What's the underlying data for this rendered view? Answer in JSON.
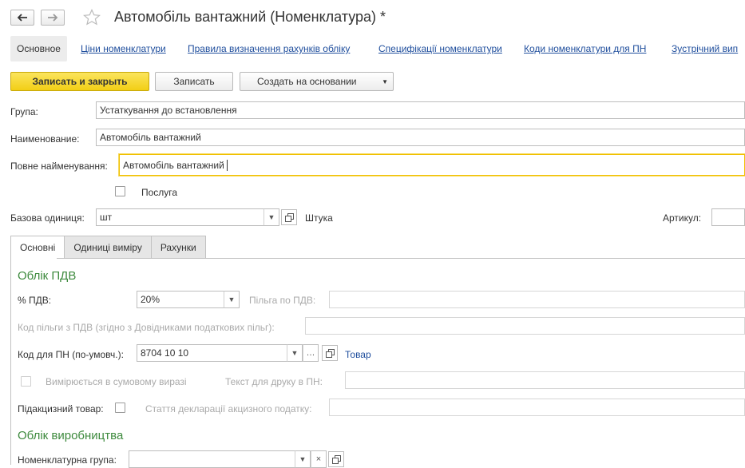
{
  "window": {
    "title": "Автомобіль вантажний (Номенклатура) *",
    "back_icon": "arrow-left-icon",
    "forward_icon": "arrow-right-icon",
    "favorite_icon": "star-icon"
  },
  "nav_tabs": {
    "main": "Основное",
    "links": [
      "Ціни номенклатури",
      "Правила визначення рахунків обліку",
      "Специфікації номенклатури",
      "Коди номенклатури для ПН",
      "Зустрічний вип"
    ]
  },
  "toolbar": {
    "save_close": "Записать и закрыть",
    "save": "Записать",
    "create_based": "Создать на основании"
  },
  "form": {
    "group_label": "Група:",
    "group_value": "Устаткування до встановлення",
    "name_label": "Наименование:",
    "name_value": "Автомобіль вантажний",
    "full_name_label": "Повне найменування:",
    "full_name_value": "Автомобіль вантажний",
    "service_label": "Послуга",
    "service_checked": false,
    "base_unit_label": "Базова одиниця:",
    "base_unit_value": "шт",
    "base_unit_full": "Штука",
    "article_label": "Артикул:",
    "article_value": ""
  },
  "inner_tabs": [
    "Основні",
    "Одиниці виміру",
    "Рахунки"
  ],
  "vat": {
    "section_title": "Облік ПДВ",
    "vat_rate_label": "% ПДВ:",
    "vat_rate_value": "20%",
    "vat_benefit_label": "Пільга по ПДВ:",
    "vat_benefit_value": "",
    "benefit_code_label": "Код пільги з ПДВ (згідно з Довідниками податкових пільг):",
    "benefit_code_value": "",
    "tax_invoice_code_label": "Код для ПН (по-умовч.):",
    "tax_invoice_code_value": "8704 10 10",
    "goods_link": "Товар",
    "sum_measured_label": "Вимірюється в сумовому виразі",
    "print_text_label": "Текст для друку в ПН:",
    "print_text_value": "",
    "excise_label": "Підакцизний товар:",
    "excise_article_label": "Стаття декларації акцизного податку:",
    "excise_article_value": ""
  },
  "production": {
    "section_title": "Облік виробництва",
    "nomenclature_group_label": "Номенклатурна група:",
    "nomenclature_group_value": ""
  }
}
